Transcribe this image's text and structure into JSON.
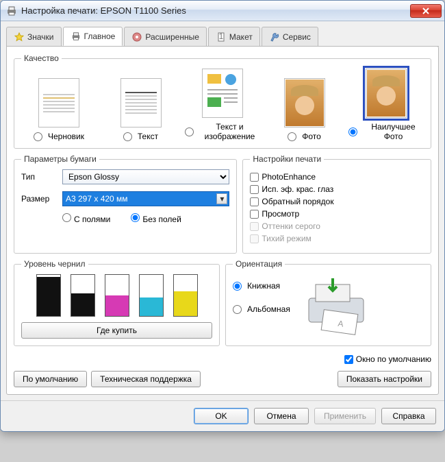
{
  "window": {
    "title": "Настройка печати: EPSON T1100 Series"
  },
  "tabs": {
    "items": [
      {
        "label": "Значки"
      },
      {
        "label": "Главное"
      },
      {
        "label": "Расширенные"
      },
      {
        "label": "Макет"
      },
      {
        "label": "Сервис"
      }
    ]
  },
  "quality": {
    "legend": "Качество",
    "options": {
      "draft": "Черновик",
      "text": "Текст",
      "textimg": "Текст и изображение",
      "photo": "Фото",
      "best": "Наилучшее Фото"
    }
  },
  "paper": {
    "legend": "Параметры бумаги",
    "type_label": "Тип",
    "type_value": "Epson Glossy",
    "size_label": "Размер",
    "size_value": "A3 297 x 420 мм",
    "margins_with": "С полями",
    "margins_without": "Без полей"
  },
  "printsettings": {
    "legend": "Настройки печати",
    "photoenhance": "PhotoEnhance",
    "redeye": "Исп. эф. крас. глаз",
    "reverse": "Обратный порядок",
    "preview": "Просмотр",
    "grayscale": "Оттенки серого",
    "quiet": "Тихий режим"
  },
  "ink": {
    "legend": "Уровень чернил",
    "buy": "Где купить",
    "levels": [
      {
        "color": "#111111",
        "pct": 95
      },
      {
        "color": "#111111",
        "pct": 55
      },
      {
        "color": "#d63ab4",
        "pct": 50
      },
      {
        "color": "#2ab8d6",
        "pct": 45
      },
      {
        "color": "#e8d81a",
        "pct": 60
      }
    ]
  },
  "orientation": {
    "legend": "Ориентация",
    "portrait": "Книжная",
    "landscape": "Альбомная"
  },
  "misc": {
    "default_window": "Окно по умолчанию",
    "defaults_btn": "По умолчанию",
    "support_btn": "Техническая поддержка",
    "show_settings_btn": "Показать настройки"
  },
  "dialog": {
    "ok": "OK",
    "cancel": "Отмена",
    "apply": "Применить",
    "help": "Справка"
  }
}
